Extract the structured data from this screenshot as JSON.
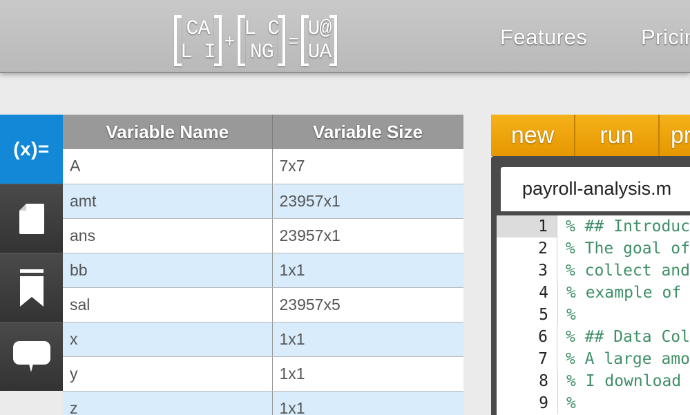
{
  "header": {
    "logo": {
      "matrix1": [
        "CA",
        "L I"
      ],
      "op1": "+",
      "matrix2": [
        "L C",
        "NG"
      ],
      "op2": "=",
      "matrix3": [
        "U@",
        "UA"
      ]
    },
    "nav": [
      "Features",
      "Pricin"
    ]
  },
  "sidebar": {
    "items": [
      {
        "label": "(x)=",
        "icon": "variables-icon",
        "active": true
      },
      {
        "icon": "file-icon"
      },
      {
        "icon": "bookmark-icon"
      },
      {
        "icon": "chat-bubble-icon"
      }
    ]
  },
  "variables": {
    "headers": [
      "Variable Name",
      "Variable Size"
    ],
    "rows": [
      [
        "A",
        "7x7"
      ],
      [
        "amt",
        "23957x1"
      ],
      [
        "ans",
        "23957x1"
      ],
      [
        "bb",
        "1x1"
      ],
      [
        "sal",
        "23957x5"
      ],
      [
        "x",
        "1x1"
      ],
      [
        "y",
        "1x1"
      ],
      [
        "z",
        "1x1"
      ]
    ]
  },
  "editor": {
    "toolbar": [
      "new",
      "run",
      "pr"
    ],
    "file_tab": "payroll-analysis.m",
    "lines": [
      {
        "num": "1",
        "code": "% ## Introduc"
      },
      {
        "num": "2",
        "code": "% The goal of"
      },
      {
        "num": "3",
        "code": "% collect and"
      },
      {
        "num": "4",
        "code": "% example of"
      },
      {
        "num": "5",
        "code": "%"
      },
      {
        "num": "6",
        "code": "% ## Data Col"
      },
      {
        "num": "7",
        "code": "% A large amo"
      },
      {
        "num": "8",
        "code": "% I download"
      },
      {
        "num": "9",
        "code": "%"
      }
    ]
  },
  "colors": {
    "active_blue": "#1288d6",
    "toolbar_orange": "#f0a20b",
    "row_blue": "#d8ecfb",
    "comment_green": "#3f8f67"
  }
}
